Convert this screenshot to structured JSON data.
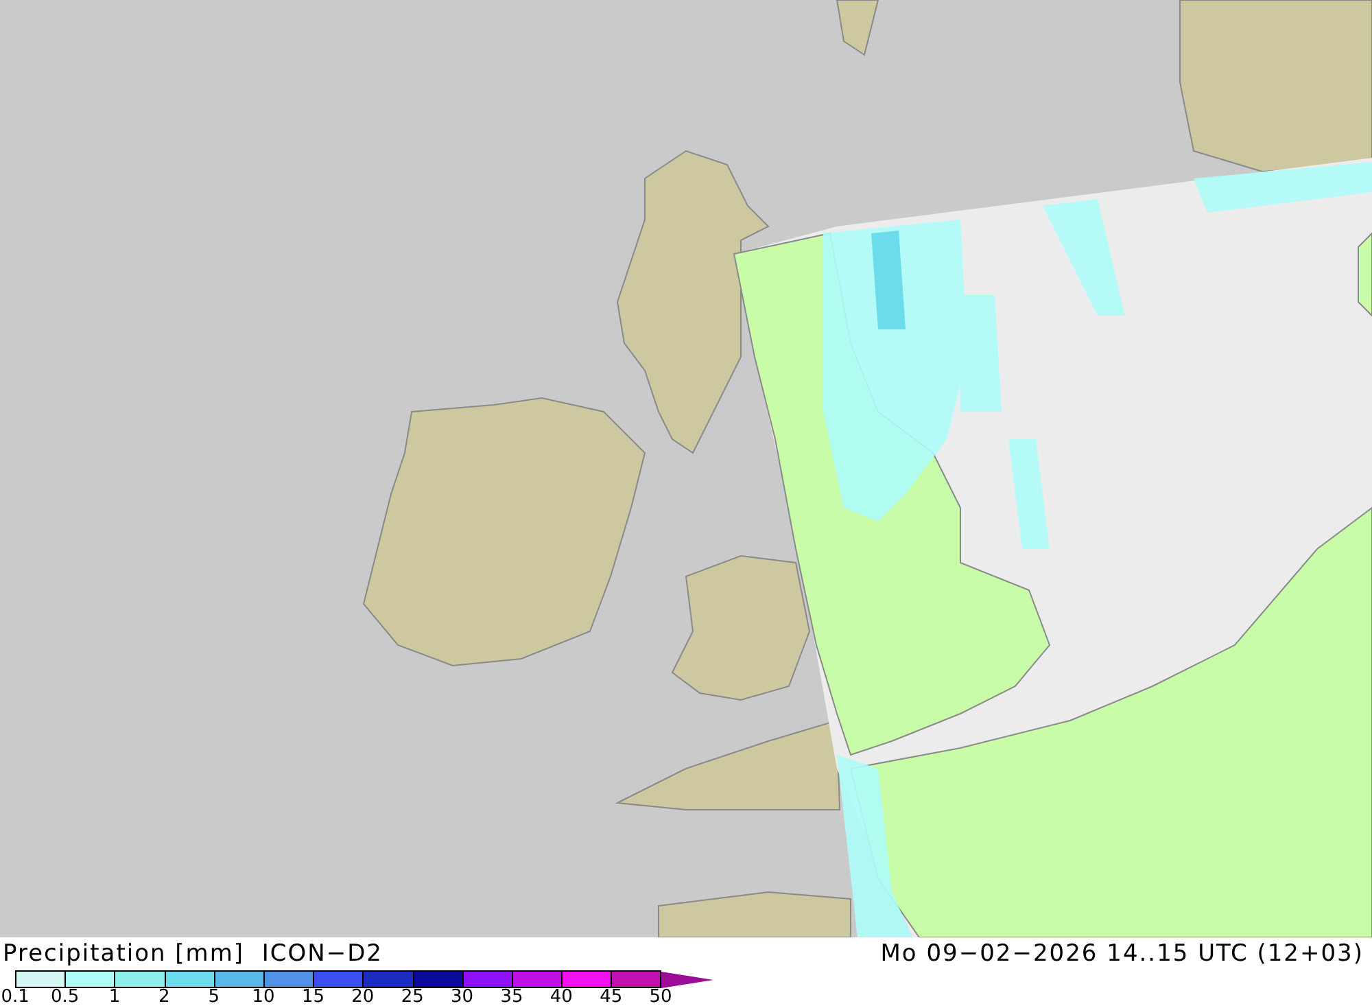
{
  "title": "Precipitation [mm]  ICON−D2",
  "valid_time": "Mo 09−02−2026 14..15 UTC (12+03)",
  "legend": {
    "bins": [
      {
        "color": "#d4f7f4"
      },
      {
        "color": "#aefcf8"
      },
      {
        "color": "#8ceee8"
      },
      {
        "color": "#6cdcec"
      },
      {
        "color": "#5ab8e8"
      },
      {
        "color": "#5092e8"
      },
      {
        "color": "#3c50f0"
      },
      {
        "color": "#1c2cc0"
      },
      {
        "color": "#0c0c9c"
      },
      {
        "color": "#9010f8"
      },
      {
        "color": "#c010e8"
      },
      {
        "color": "#f010f0"
      },
      {
        "color": "#c010b0"
      }
    ],
    "arrow": {
      "color": "#9c0c98"
    },
    "ticks": [
      "0.1",
      "0.5",
      "1",
      "2",
      "5",
      "10",
      "15",
      "20",
      "25",
      "30",
      "35",
      "40",
      "45",
      "50"
    ]
  }
}
